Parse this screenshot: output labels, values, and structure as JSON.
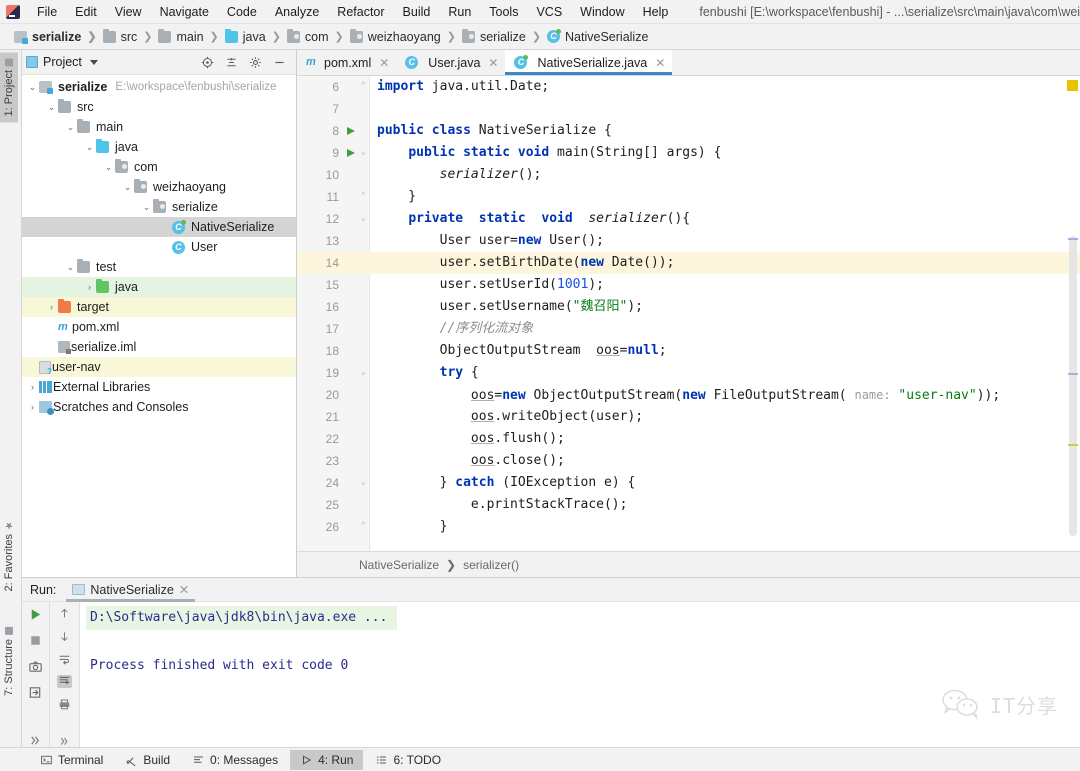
{
  "window": {
    "title": "fenbushi [E:\\workspace\\fenbushi] - ...\\serialize\\src\\main\\java\\com\\weizhaoyang\\s",
    "logo_icon": "intellij-idea-logo"
  },
  "menubar": {
    "items": [
      {
        "label": "File"
      },
      {
        "label": "Edit"
      },
      {
        "label": "View"
      },
      {
        "label": "Navigate"
      },
      {
        "label": "Code"
      },
      {
        "label": "Analyze"
      },
      {
        "label": "Refactor"
      },
      {
        "label": "Build"
      },
      {
        "label": "Run"
      },
      {
        "label": "Tools"
      },
      {
        "label": "VCS"
      },
      {
        "label": "Window"
      },
      {
        "label": "Help"
      }
    ]
  },
  "breadcrumb": {
    "items": [
      {
        "label": "serialize",
        "icon": "module-icon",
        "bold": true
      },
      {
        "label": "src",
        "icon": "folder-icon",
        "bold": false
      },
      {
        "label": "main",
        "icon": "folder-icon",
        "bold": false
      },
      {
        "label": "java",
        "icon": "source-folder-icon",
        "bold": false
      },
      {
        "label": "com",
        "icon": "package-icon",
        "bold": false
      },
      {
        "label": "weizhaoyang",
        "icon": "package-icon",
        "bold": false
      },
      {
        "label": "serialize",
        "icon": "package-icon",
        "bold": false
      },
      {
        "label": "NativeSerialize",
        "icon": "java-class-icon",
        "bold": false
      }
    ]
  },
  "left_strip": {
    "project_tab": "1: Project",
    "favorites_tab": "2: Favorites",
    "structure_tab": "7: Structure"
  },
  "project_panel": {
    "title": "Project",
    "toolbar": [
      {
        "name": "locate-icon"
      },
      {
        "name": "collapse-all-icon"
      },
      {
        "name": "gear-icon"
      },
      {
        "name": "minimize-icon"
      }
    ],
    "tree": [
      {
        "label": "serialize",
        "path": "E:\\workspace\\fenbushi\\serialize",
        "indent": 0,
        "arrow": "down",
        "icon": "module-icon",
        "bold": true,
        "state": "normal"
      },
      {
        "label": "src",
        "path": "",
        "indent": 1,
        "arrow": "down",
        "icon": "folder-icon",
        "bold": false,
        "state": "normal"
      },
      {
        "label": "main",
        "path": "",
        "indent": 2,
        "arrow": "down",
        "icon": "folder-icon",
        "bold": false,
        "state": "normal"
      },
      {
        "label": "java",
        "path": "",
        "indent": 3,
        "arrow": "down",
        "icon": "source-folder-icon",
        "bold": false,
        "state": "normal"
      },
      {
        "label": "com",
        "path": "",
        "indent": 4,
        "arrow": "down",
        "icon": "package-icon",
        "bold": false,
        "state": "normal"
      },
      {
        "label": "weizhaoyang",
        "path": "",
        "indent": 5,
        "arrow": "down",
        "icon": "package-icon",
        "bold": false,
        "state": "normal"
      },
      {
        "label": "serialize",
        "path": "",
        "indent": 6,
        "arrow": "down",
        "icon": "package-icon",
        "bold": false,
        "state": "normal"
      },
      {
        "label": "NativeSerialize",
        "path": "",
        "indent": 7,
        "arrow": "none",
        "icon": "java-class-runnable-icon",
        "bold": false,
        "state": "selected"
      },
      {
        "label": "User",
        "path": "",
        "indent": 7,
        "arrow": "none",
        "icon": "java-class-icon",
        "bold": false,
        "state": "normal"
      },
      {
        "label": "test",
        "path": "",
        "indent": 2,
        "arrow": "down",
        "icon": "folder-icon",
        "bold": false,
        "state": "normal"
      },
      {
        "label": "java",
        "path": "",
        "indent": 3,
        "arrow": "right",
        "icon": "test-source-folder-icon",
        "bold": false,
        "state": "green"
      },
      {
        "label": "target",
        "path": "",
        "indent": 1,
        "arrow": "right",
        "icon": "excluded-folder-icon",
        "bold": false,
        "state": "yellow"
      },
      {
        "label": "pom.xml",
        "path": "",
        "indent": 1,
        "arrow": "none",
        "icon": "maven-icon",
        "bold": false,
        "state": "normal"
      },
      {
        "label": "serialize.iml",
        "path": "",
        "indent": 1,
        "arrow": "none",
        "icon": "iml-icon",
        "bold": false,
        "state": "normal"
      },
      {
        "label": "user-nav",
        "path": "",
        "indent": 0,
        "arrow": "none",
        "icon": "unknown-file-icon",
        "bold": false,
        "state": "yellow"
      },
      {
        "label": "External Libraries",
        "path": "",
        "indent": 0,
        "arrow": "right",
        "icon": "library-icon",
        "bold": false,
        "state": "normal"
      },
      {
        "label": "Scratches and Consoles",
        "path": "",
        "indent": 0,
        "arrow": "right",
        "icon": "scratches-icon",
        "bold": false,
        "state": "normal"
      }
    ]
  },
  "editor": {
    "tabs": [
      {
        "label": "pom.xml",
        "icon": "maven-icon",
        "active": false
      },
      {
        "label": "User.java",
        "icon": "java-class-icon",
        "active": false
      },
      {
        "label": "NativeSerialize.java",
        "icon": "java-class-runnable-icon",
        "active": true
      }
    ],
    "breadcrumb": [
      "NativeSerialize",
      "serializer()"
    ],
    "lines": [
      {
        "num": "6",
        "fold": "collapse",
        "run": false,
        "current": false
      },
      {
        "num": "7",
        "fold": "",
        "run": false,
        "current": false
      },
      {
        "num": "8",
        "fold": "",
        "run": true,
        "current": false
      },
      {
        "num": "9",
        "fold": "expand",
        "run": true,
        "current": false
      },
      {
        "num": "10",
        "fold": "",
        "run": false,
        "current": false
      },
      {
        "num": "11",
        "fold": "collapse",
        "run": false,
        "current": false
      },
      {
        "num": "12",
        "fold": "expand",
        "run": false,
        "current": false
      },
      {
        "num": "13",
        "fold": "",
        "run": false,
        "current": false
      },
      {
        "num": "14",
        "fold": "",
        "run": false,
        "current": true
      },
      {
        "num": "15",
        "fold": "",
        "run": false,
        "current": false
      },
      {
        "num": "16",
        "fold": "",
        "run": false,
        "current": false
      },
      {
        "num": "17",
        "fold": "",
        "run": false,
        "current": false
      },
      {
        "num": "18",
        "fold": "",
        "run": false,
        "current": false
      },
      {
        "num": "19",
        "fold": "expand",
        "run": false,
        "current": false
      },
      {
        "num": "20",
        "fold": "",
        "run": false,
        "current": false
      },
      {
        "num": "21",
        "fold": "",
        "run": false,
        "current": false
      },
      {
        "num": "22",
        "fold": "",
        "run": false,
        "current": false
      },
      {
        "num": "23",
        "fold": "",
        "run": false,
        "current": false
      },
      {
        "num": "24",
        "fold": "expand",
        "run": false,
        "current": false
      },
      {
        "num": "25",
        "fold": "",
        "run": false,
        "current": false
      },
      {
        "num": "26",
        "fold": "collapse",
        "run": false,
        "current": false
      }
    ],
    "source_text": [
      "import java.util.Date;",
      "",
      "public class NativeSerialize {",
      "    public static void main(String[] args) {",
      "        serializer();",
      "    }",
      "    private  static  void  serializer(){",
      "        User user=new User();",
      "        user.setBirthDate(new Date());",
      "        user.setUserId(1001);",
      "        user.setUsername(\"魏召阳\");",
      "        //序列化流对象",
      "        ObjectOutputStream  oos=null;",
      "        try {",
      "            oos=new ObjectOutputStream(new FileOutputStream( name: \"user-nav\"));",
      "            oos.writeObject(user);",
      "            oos.flush();",
      "            oos.close();",
      "        } catch (IOException e) {",
      "            e.printStackTrace();",
      "        }"
    ]
  },
  "run_panel": {
    "label": "Run:",
    "tab_label": "NativeSerialize",
    "toolbar_left": [
      {
        "name": "rerun-icon"
      },
      {
        "name": "stop-icon"
      },
      {
        "name": "screenshot-icon"
      },
      {
        "name": "export-icon"
      },
      {
        "name": "more-icon"
      }
    ],
    "toolbar_right": [
      {
        "name": "arrow-up-icon"
      },
      {
        "name": "arrow-down-icon"
      },
      {
        "name": "soft-wrap-icon"
      },
      {
        "name": "scroll-to-end-icon"
      },
      {
        "name": "print-icon"
      },
      {
        "name": "more-icon"
      }
    ],
    "console_lines": [
      {
        "text": "D:\\Software\\java\\jdk8\\bin\\java.exe ...",
        "highlight": true
      },
      {
        "text": "",
        "highlight": false
      },
      {
        "text": "Process finished with exit code 0",
        "highlight": false
      }
    ]
  },
  "watermark": {
    "text": "IT分享",
    "icon": "wechat-icon"
  },
  "statusbar": {
    "items": [
      {
        "label": "Terminal",
        "icon": "terminal-icon",
        "active": false
      },
      {
        "label": "Build",
        "icon": "build-icon",
        "active": false
      },
      {
        "label": "0: Messages",
        "icon": "messages-icon",
        "active": false
      },
      {
        "label": "4: Run",
        "icon": "run-icon",
        "active": true
      },
      {
        "label": "6: TODO",
        "icon": "todo-icon",
        "active": false
      }
    ]
  },
  "colors": {
    "accent": "#3e86c7",
    "keyword": "#0033b3",
    "string": "#067d17",
    "number": "#1750eb",
    "comment": "#8c8c8c",
    "run_green": "#3f9e3f",
    "warning": "#e8c100"
  }
}
